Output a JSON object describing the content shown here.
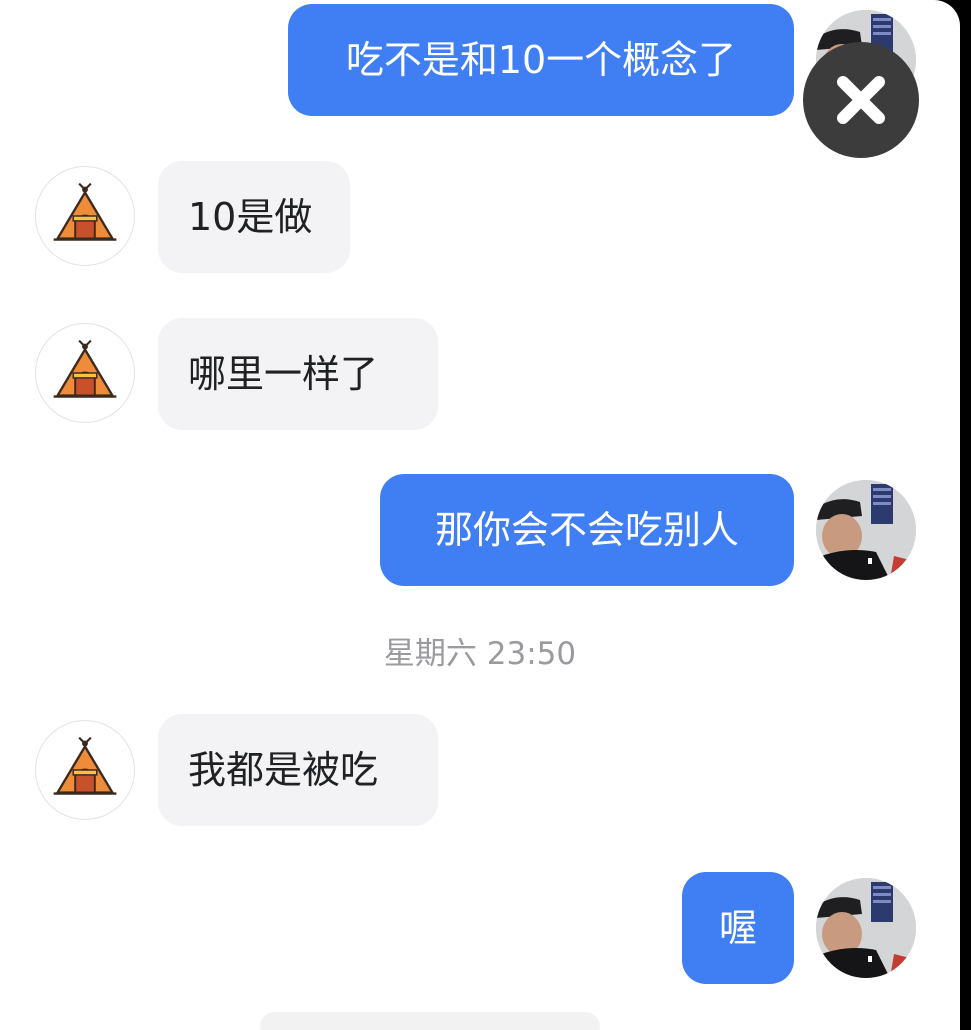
{
  "messages": [
    {
      "text": "吃不是和10一个概念了",
      "direction": "outgoing"
    },
    {
      "text": "10是做",
      "direction": "incoming"
    },
    {
      "text": "哪里一样了",
      "direction": "incoming"
    },
    {
      "text": "那你会不会吃别人",
      "direction": "outgoing"
    },
    {
      "text": "我都是被吃",
      "direction": "incoming"
    },
    {
      "text": "喔",
      "direction": "outgoing"
    }
  ],
  "timestamp": "星期六 23:50",
  "icons": {
    "close": "close-icon",
    "contact_avatar": "tent-icon",
    "self_avatar": "user-photo"
  },
  "colors": {
    "outgoing_bubble": "#3f7ef3",
    "incoming_bubble": "#f3f3f5",
    "tent_orange": "#ef8c3a",
    "close_button": "#3c3c3c"
  }
}
